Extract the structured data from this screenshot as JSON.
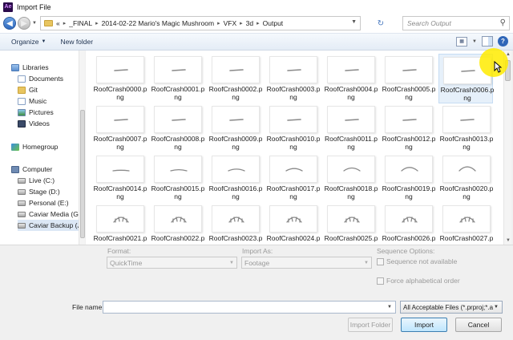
{
  "window": {
    "title": "Import File",
    "app_icon": "Ae"
  },
  "address": {
    "crumbs": [
      "_FINAL",
      "2014-02-22 Mario's Magic Mushroom",
      "VFX",
      "3d",
      "Output"
    ],
    "overflow": "«"
  },
  "search": {
    "placeholder": "Search Output"
  },
  "toolbar": {
    "organize_label": "Organize",
    "new_folder_label": "New folder"
  },
  "nav": {
    "items": [
      {
        "label": "Libraries",
        "icon": "library-icon"
      },
      {
        "label": "Documents",
        "icon": "documents-icon"
      },
      {
        "label": "Git",
        "icon": "folder-icon"
      },
      {
        "label": "Music",
        "icon": "music-icon"
      },
      {
        "label": "Pictures",
        "icon": "pictures-icon"
      },
      {
        "label": "Videos",
        "icon": "videos-icon"
      },
      {
        "label": "Homegroup",
        "icon": "homegroup-icon"
      },
      {
        "label": "Computer",
        "icon": "computer-icon"
      },
      {
        "label": "Live (C:)",
        "icon": "drive-icon"
      },
      {
        "label": "Stage (D:)",
        "icon": "drive-icon"
      },
      {
        "label": "Personal (E:)",
        "icon": "drive-icon"
      },
      {
        "label": "Caviar Media (G:",
        "icon": "drive-icon"
      },
      {
        "label": "Caviar Backup (J:",
        "icon": "drive-icon"
      }
    ]
  },
  "files": [
    "RoofCrash0000.png",
    "RoofCrash0001.png",
    "RoofCrash0002.png",
    "RoofCrash0003.png",
    "RoofCrash0004.png",
    "RoofCrash0005.png",
    "RoofCrash0006.png",
    "RoofCrash0007.png",
    "RoofCrash0008.png",
    "RoofCrash0009.png",
    "RoofCrash0010.png",
    "RoofCrash0011.png",
    "RoofCrash0012.png",
    "RoofCrash0013.png",
    "RoofCrash0014.png",
    "RoofCrash0015.png",
    "RoofCrash0016.png",
    "RoofCrash0017.png",
    "RoofCrash0018.png",
    "RoofCrash0019.png",
    "RoofCrash0020.png",
    "RoofCrash0021.png",
    "RoofCrash0022.png",
    "RoofCrash0023.png",
    "RoofCrash0024.png",
    "RoofCrash0025.png",
    "RoofCrash0026.png",
    "RoofCrash0027.png"
  ],
  "selected_file": "RoofCrash0006.png",
  "options": {
    "format_label": "Format:",
    "format_value": "QuickTime",
    "import_as_label": "Import As:",
    "import_as_value": "Footage",
    "sequence_options_label": "Sequence Options:",
    "sequence_not_available": "Sequence not available",
    "force_alphabetical": "Force alphabetical order"
  },
  "filename": {
    "label": "File name:",
    "value": ""
  },
  "filter": {
    "selected": "All Acceptable Files (*.prproj;*.a"
  },
  "buttons": {
    "import_folder": "Import Folder",
    "import": "Import",
    "cancel": "Cancel"
  },
  "colors": {
    "accent": "#3c7fb1",
    "highlight": "#ffeb00",
    "selection": "#e6f0fa"
  }
}
